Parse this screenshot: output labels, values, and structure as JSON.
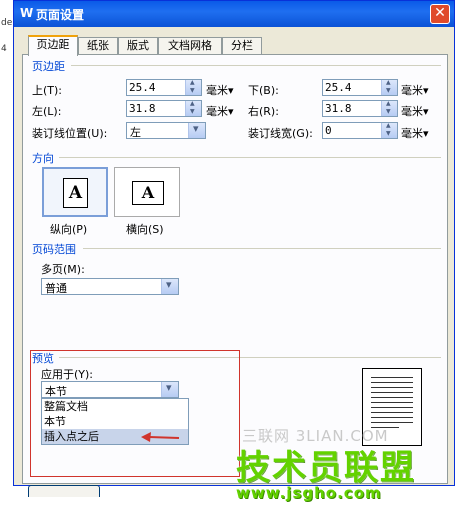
{
  "background_fragments": [
    "de",
    "4"
  ],
  "window": {
    "title": "页面设置",
    "title_icon": "W",
    "close_glyph": "✕"
  },
  "tabs": [
    "页边距",
    "纸张",
    "版式",
    "文档网格",
    "分栏"
  ],
  "margins": {
    "section": "页边距",
    "top_label": "上(T):",
    "top_value": "25.4",
    "bottom_label": "下(B):",
    "bottom_value": "25.4",
    "left_label": "左(L):",
    "left_value": "31.8",
    "right_label": "右(R):",
    "right_value": "31.8",
    "gutter_pos_label": "装订线位置(U):",
    "gutter_pos_value": "左",
    "gutter_width_label": "装订线宽(G):",
    "gutter_width_value": "0",
    "unit": "毫米▾"
  },
  "orientation": {
    "section": "方向",
    "portrait_label": "纵向(P)",
    "landscape_label": "横向(S)",
    "icon_letter": "A"
  },
  "page_range": {
    "section": "页码范围",
    "multi_label": "多页(M):",
    "multi_value": "普通"
  },
  "preview": {
    "section": "预览",
    "apply_label": "应用于(Y):",
    "apply_value": "本节",
    "options": [
      "整篇文档",
      "本节",
      "插入点之后"
    ]
  },
  "watermark": {
    "line1": "三联网 3LIAN.COM",
    "line2": "技术员联盟",
    "line3": "www.jsgho.com"
  }
}
